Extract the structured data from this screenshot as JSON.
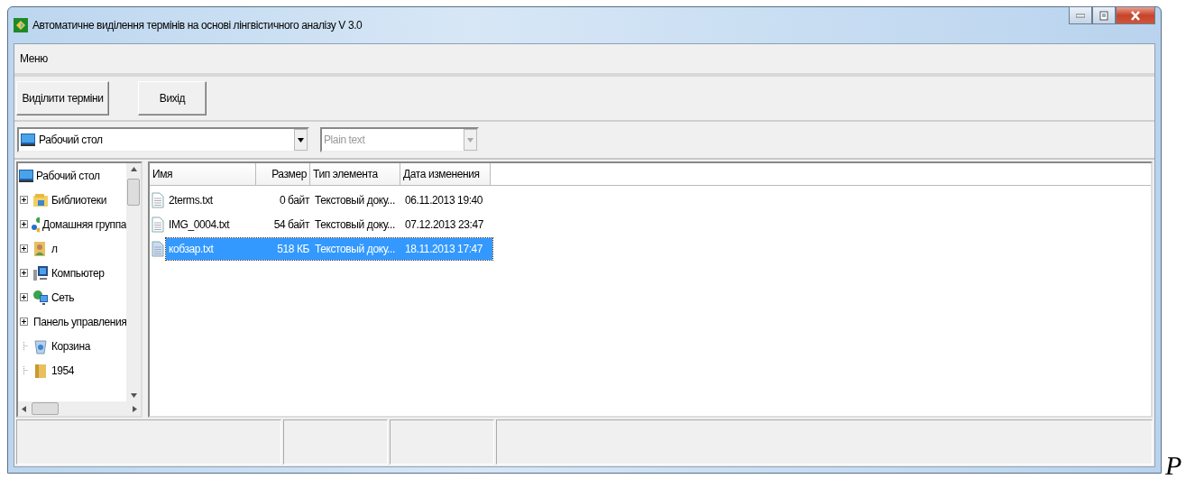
{
  "window": {
    "title": "Автоматичне виділення термінів на основі лінгвістичного аналізу V 3.0"
  },
  "menu": [
    "Меню"
  ],
  "toolbar": {
    "buttons": [
      "Виділити терміни",
      "Вихід"
    ]
  },
  "location_combo": {
    "value": "Рабочий стол"
  },
  "format_combo": {
    "value": "Plain text",
    "disabled": true
  },
  "tree": {
    "label": "Рабочий стол",
    "kind": "desktop",
    "children": [
      {
        "label": "Библиотеки",
        "kind": "library",
        "expandable": true
      },
      {
        "label": "Домашняя группа",
        "kind": "homegroup",
        "expandable": true
      },
      {
        "label": "л",
        "kind": "user",
        "expandable": true
      },
      {
        "label": "Компьютер",
        "kind": "computer",
        "expandable": true
      },
      {
        "label": "Сеть",
        "kind": "network",
        "expandable": true
      },
      {
        "label": "Панель управления",
        "kind": "control",
        "expandable": true
      },
      {
        "label": "Корзина",
        "kind": "recycle",
        "expandable": false
      },
      {
        "label": "1954",
        "kind": "folder",
        "expandable": false
      }
    ]
  },
  "file_list": {
    "columns": [
      "Имя",
      "Размер",
      "Тип элемента",
      "Дата изменения"
    ],
    "rows": [
      {
        "name": "2terms.txt",
        "size": "0 байт",
        "type": "Текстовый доку...",
        "date": "06.11.2013 19:40",
        "selected": false
      },
      {
        "name": "IMG_0004.txt",
        "size": "54 байт",
        "type": "Текстовый доку...",
        "date": "07.12.2013 23:47",
        "selected": false
      },
      {
        "name": "кобзар.txt",
        "size": "518 КБ",
        "type": "Текстовый доку...",
        "date": "18.11.2013 17:47",
        "selected": true
      }
    ]
  },
  "page_text": "P"
}
